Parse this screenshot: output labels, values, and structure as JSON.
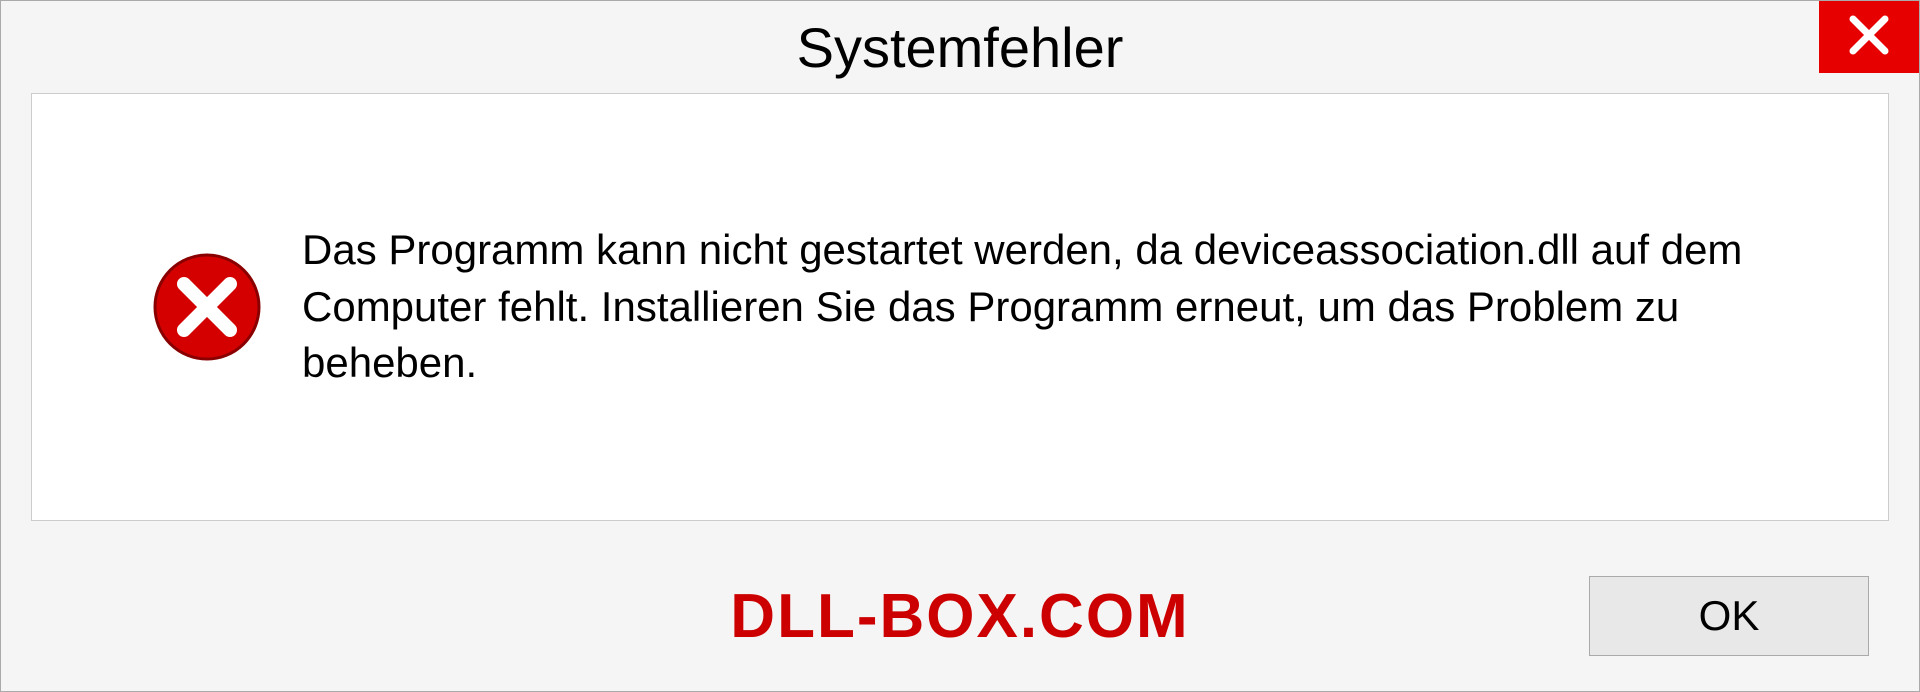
{
  "dialog": {
    "title": "Systemfehler",
    "message": "Das Programm kann nicht gestartet werden, da deviceassociation.dll auf dem Computer fehlt. Installieren Sie das Programm erneut, um das Problem zu beheben.",
    "ok_label": "OK"
  },
  "watermark": "DLL-BOX.COM"
}
